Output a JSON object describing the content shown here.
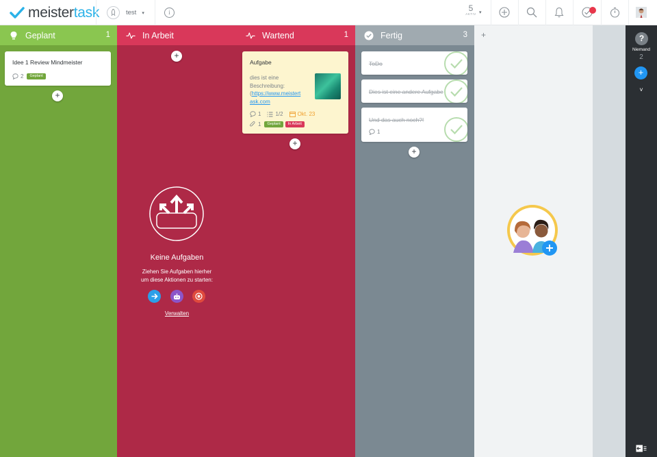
{
  "app": {
    "logo_part1": "meister",
    "logo_part2": "task"
  },
  "project": {
    "name": "test"
  },
  "header": {
    "active_count": "5",
    "active_label": "AKTIV",
    "icons": [
      "add-icon",
      "search-icon",
      "bell-icon",
      "checkmark-icon",
      "stopwatch-icon",
      "avatar"
    ]
  },
  "colors": {
    "geplant": "#72a63c",
    "in_arbeit": "#ae2947",
    "wartend": "#ae2947",
    "fertig": "#7b8992",
    "accent": "#2196f3"
  },
  "columns": [
    {
      "title": "Geplant",
      "count": "1",
      "icon": "lightbulb-icon"
    },
    {
      "title": "In Arbeit",
      "count": "",
      "icon": "pulse-icon"
    },
    {
      "title": "Wartend",
      "count": "1",
      "icon": "pulse-icon"
    },
    {
      "title": "Fertig",
      "count": "3",
      "icon": "check-circle-icon"
    }
  ],
  "geplant_cards": [
    {
      "title": "Idee 1 Review Mindmeister",
      "comments": "2",
      "tag": "Geplant"
    }
  ],
  "in_arbeit_empty": {
    "title": "Keine Aufgaben",
    "line1": "Ziehen Sie Aufgaben hierher",
    "line2": "um diese Aktionen zu starten:",
    "link": "Verwalten"
  },
  "wartend_card": {
    "title": "Aufgabe",
    "desc1": "dies ist eine",
    "desc2": "Beschreibung:",
    "link1": "https://www.meistert",
    "link2": "ask.com",
    "open_paren": "(",
    "comments": "1",
    "checklist": "1/2",
    "due": "Okt. 23",
    "attachments": "1",
    "tags": [
      "Geplant",
      "In Arbeit"
    ]
  },
  "fertig_cards": [
    {
      "title": "ToDo"
    },
    {
      "title": "Dies ist eine andere Aufgabe"
    },
    {
      "title": "Und das auch noch?!",
      "comments": "1"
    }
  ],
  "add_column": "+",
  "sidebar": {
    "help": "?",
    "user_label": "Niemand",
    "user_count": "2",
    "add": "+",
    "expand": "˅"
  }
}
